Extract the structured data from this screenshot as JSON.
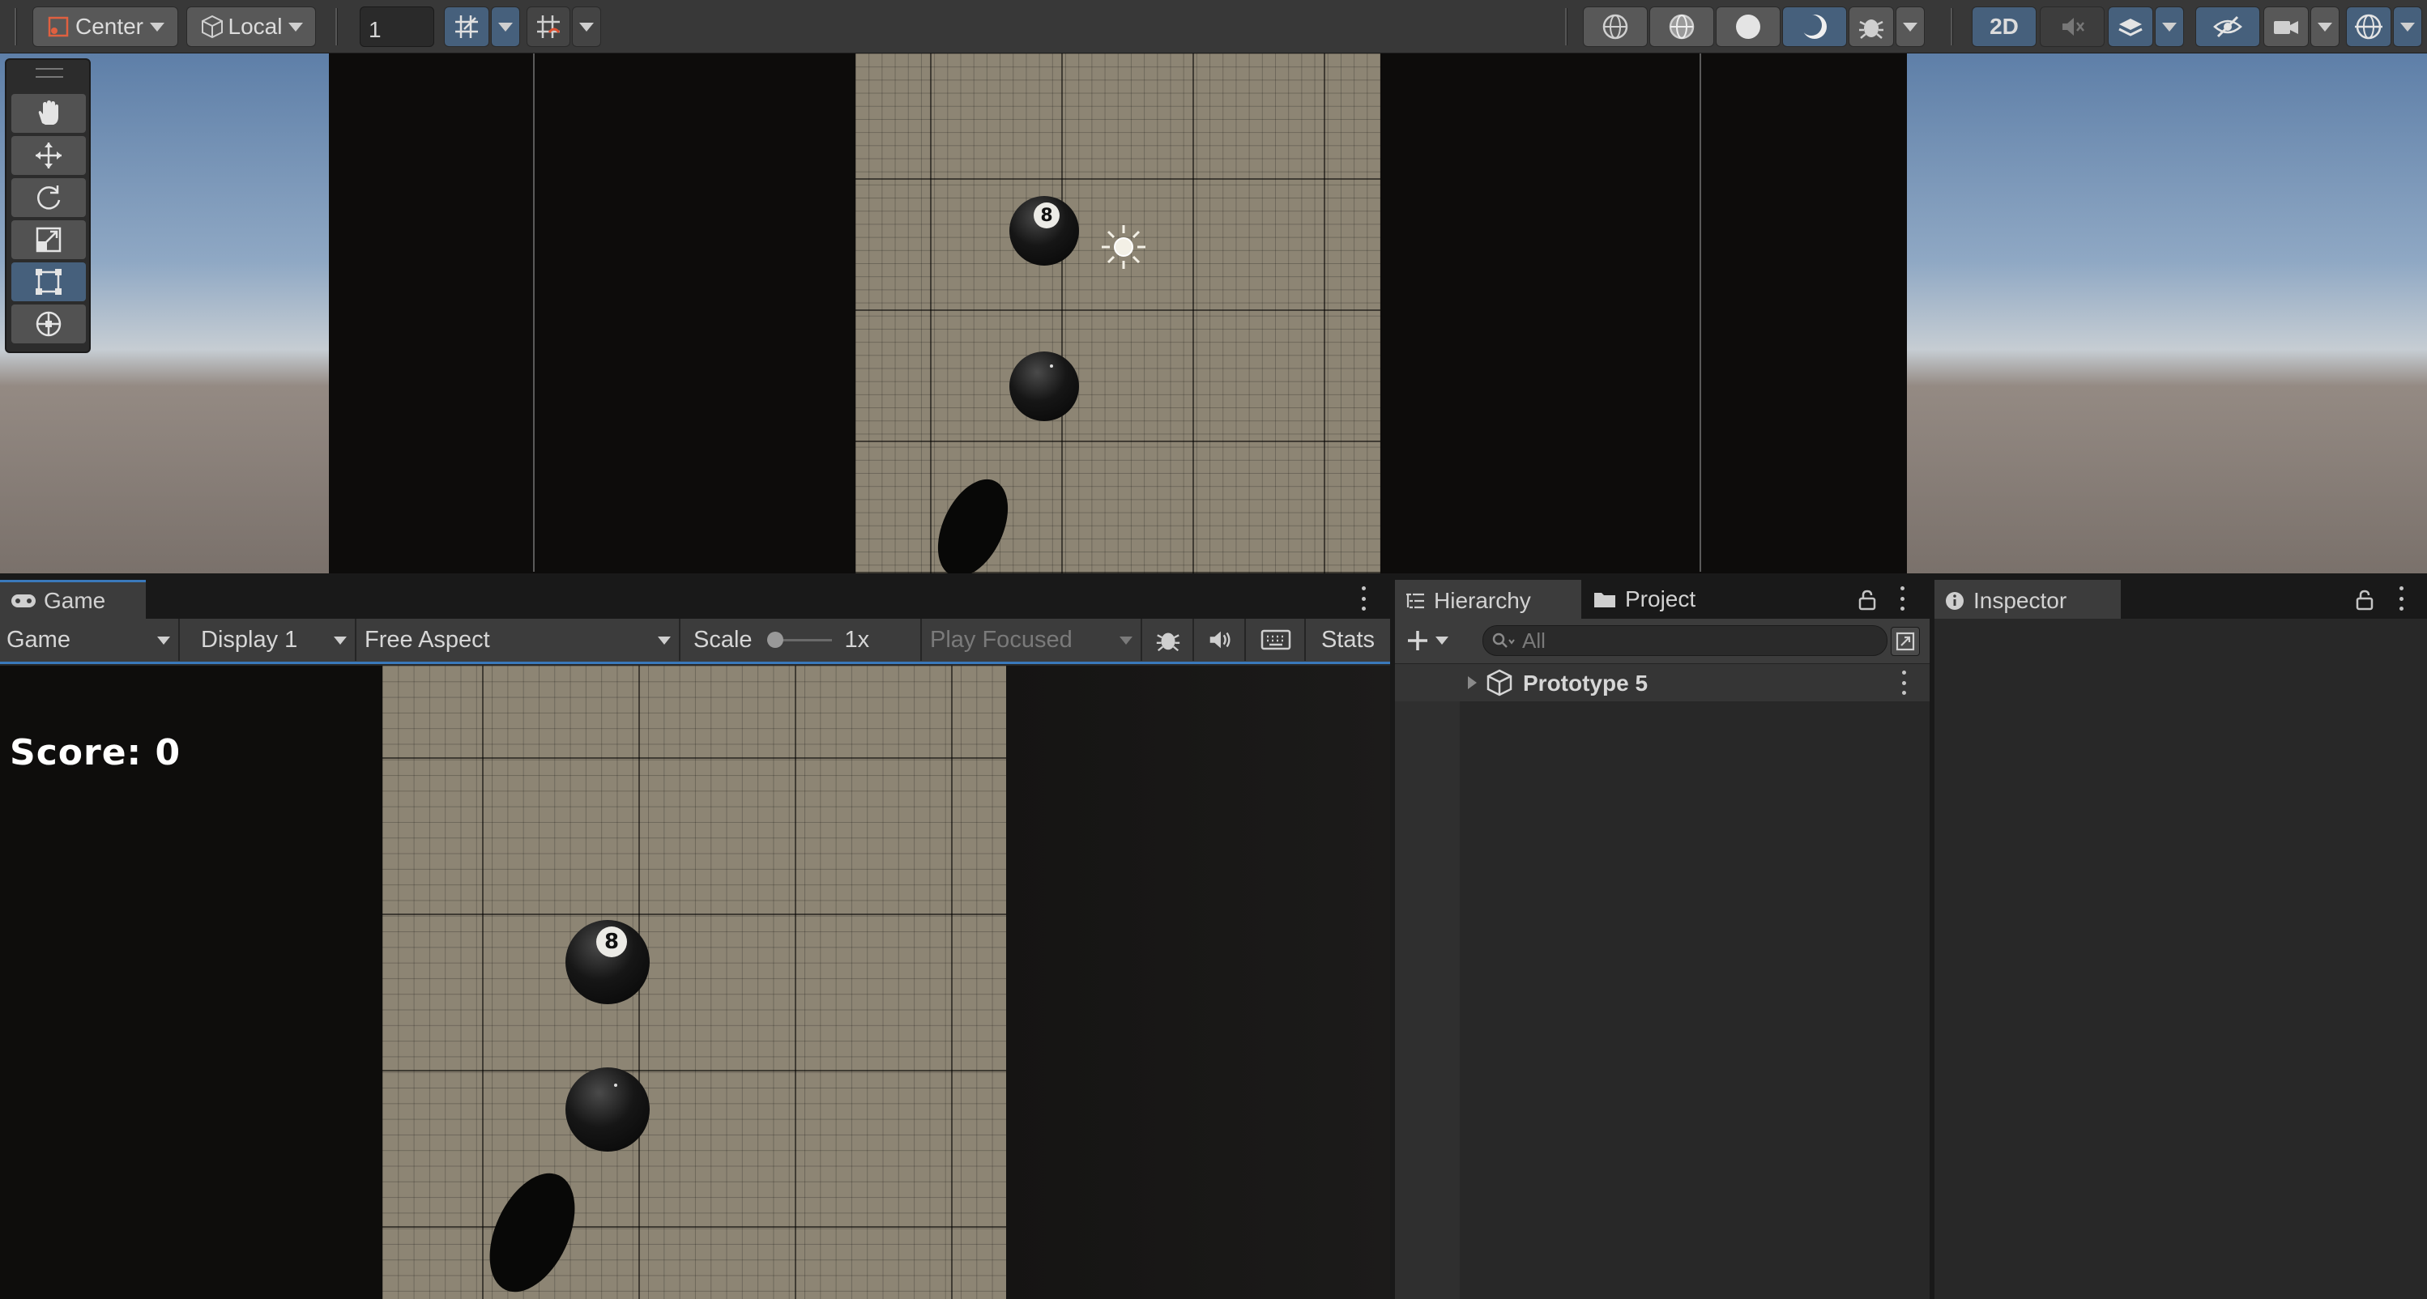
{
  "scene_toolbar": {
    "pivot_label": "Center",
    "space_label": "Local",
    "snap_value": "1",
    "mode_2d_label": "2D"
  },
  "tools": [
    {
      "name": "hand-tool",
      "icon": "hand-icon",
      "active": false
    },
    {
      "name": "move-tool",
      "icon": "move-arrows-icon",
      "active": false
    },
    {
      "name": "rotate-tool",
      "icon": "rotate-icon",
      "active": false
    },
    {
      "name": "scale-tool",
      "icon": "scale-icon",
      "active": false
    },
    {
      "name": "rect-tool",
      "icon": "rect-transform-icon",
      "active": true
    },
    {
      "name": "transform-tool",
      "icon": "transform-icon",
      "active": false
    }
  ],
  "scene_view": {
    "ball_number": "8"
  },
  "game_panel": {
    "tab_label": "Game",
    "view_dropdown": "Game",
    "display_dropdown": "Display 1",
    "aspect_dropdown": "Free Aspect",
    "scale_label": "Scale",
    "scale_value": "1x",
    "play_mode_dropdown": "Play Focused",
    "stats_label": "Stats",
    "score_text": "Score: 0",
    "ball_number": "8"
  },
  "hierarchy_panel": {
    "tab_label": "Hierarchy",
    "project_tab_label": "Project",
    "search_placeholder": "All",
    "root_item": "Prototype 5"
  },
  "inspector_panel": {
    "tab_label": "Inspector"
  },
  "colors": {
    "accent": "#3a79bb",
    "active_button": "#46607c",
    "panel_bg": "#282828",
    "toolbar_bg": "#383838"
  }
}
